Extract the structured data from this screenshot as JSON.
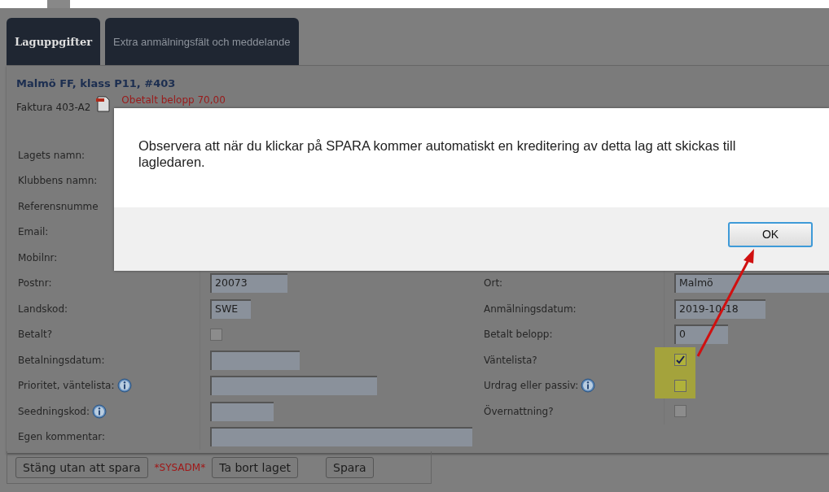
{
  "tabs": [
    {
      "label": "Laguppgifter",
      "selected": true
    },
    {
      "label": "Extra anmälningsfält och meddelande",
      "selected": false
    }
  ],
  "team_title": "Malmö FF, klass P11, #403",
  "invoice": {
    "label": "Faktura 403-A2",
    "balance": "Obetalt belopp 70,00"
  },
  "rows": [
    {
      "left": {
        "label": "Lagets namn:",
        "kind": "none"
      }
    },
    {
      "left": {
        "label": "Klubbens namn:",
        "kind": "none"
      }
    },
    {
      "left": {
        "label": "Referensnumme",
        "kind": "none"
      }
    },
    {
      "left": {
        "label": "Email:",
        "kind": "none"
      }
    },
    {
      "left": {
        "label": "Mobilnr:",
        "kind": "none"
      }
    },
    {
      "left": {
        "label": "Postnr:",
        "kind": "text",
        "value": "20073"
      },
      "right": {
        "label": "Ort:",
        "kind": "text",
        "value": "Malmö"
      }
    },
    {
      "left": {
        "label": "Landskod:",
        "kind": "text",
        "value": "SWE"
      },
      "right": {
        "label": "Anmälningsdatum:",
        "kind": "text",
        "value": "2019-10-18"
      }
    },
    {
      "left": {
        "label": "Betalt?",
        "kind": "checkbox",
        "checked": false
      },
      "right": {
        "label": "Betalt belopp:",
        "kind": "text",
        "value": "0"
      }
    },
    {
      "left": {
        "label": "Betalningsdatum:",
        "kind": "text"
      },
      "right": {
        "label": "Väntelista?",
        "kind": "checkbox",
        "checked": true,
        "highlighted": true
      }
    },
    {
      "left": {
        "label": "Prioritet, väntelista:",
        "info": true,
        "kind": "text"
      },
      "right": {
        "label": "Urdrag eller passiv:",
        "info": true,
        "kind": "checkbox",
        "checked": false,
        "highlighted": true
      }
    },
    {
      "left": {
        "label": "Seedningskod:",
        "info": true,
        "kind": "text"
      },
      "right": {
        "label": "Övernattning?",
        "kind": "checkbox",
        "checked": false
      }
    },
    {
      "left": {
        "label": "Egen kommentar:",
        "kind": "wide"
      }
    }
  ],
  "buttons": [
    {
      "label": "Stäng utan att spara",
      "kind": "button"
    },
    {
      "label": "*SYSADM*",
      "kind": "tag"
    },
    {
      "label": "Ta bort laget",
      "kind": "button"
    },
    {
      "label": "Spara",
      "kind": "button"
    }
  ],
  "dialog": {
    "message": "Observera att när du klickar på SPARA kommer automatiskt en kreditering av detta lag att skickas till lagledaren.",
    "ok": "OK"
  }
}
